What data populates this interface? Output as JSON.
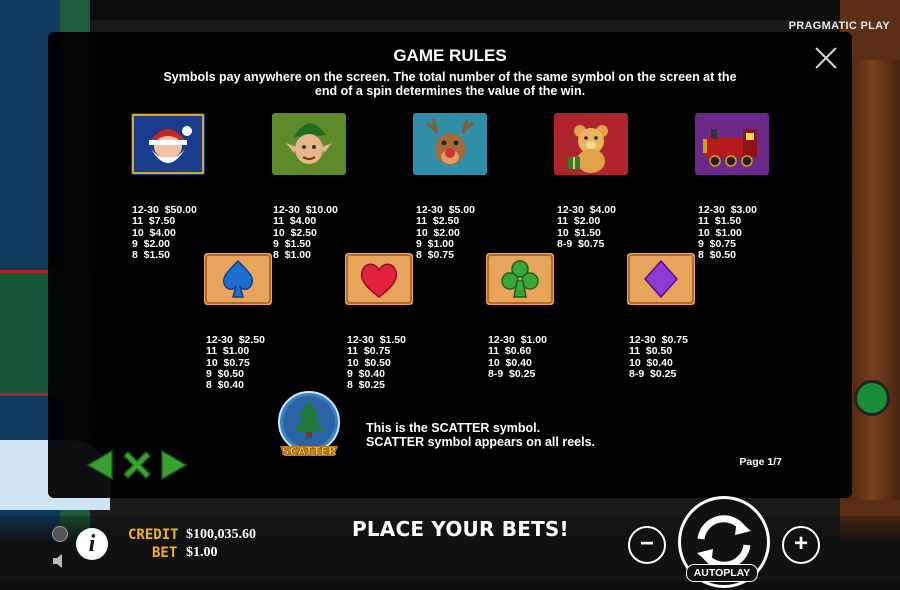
{
  "brand": "PRAGMATIC PLAY",
  "dialog": {
    "title": "GAME RULES",
    "subtitle": "Symbols pay anywhere on the screen. The total number of the same symbol on the screen at the end of a spin determines the value of the win.",
    "page": "Page 1/7"
  },
  "symbols_row1": [
    {
      "name": "santa",
      "pays": [
        "12-30  $50.00",
        "11  $7.50",
        "10  $4.00",
        "9  $2.00",
        "8  $1.50"
      ]
    },
    {
      "name": "elf",
      "pays": [
        "12-30  $10.00",
        "11  $4.00",
        "10  $2.50",
        "9  $1.50",
        "8  $1.00"
      ]
    },
    {
      "name": "reindeer",
      "pays": [
        "12-30  $5.00",
        "11  $2.50",
        "10  $2.00",
        "9  $1.00",
        "8  $0.75"
      ]
    },
    {
      "name": "teddy-bear",
      "pays": [
        "12-30  $4.00",
        "11  $2.00",
        "10  $1.50",
        "8-9  $0.75"
      ]
    },
    {
      "name": "train",
      "pays": [
        "12-30  $3.00",
        "11  $1.50",
        "10  $1.00",
        "9  $0.75",
        "8  $0.50"
      ]
    }
  ],
  "symbols_row2": [
    {
      "name": "spade",
      "pays": [
        "12-30  $2.50",
        "11  $1.00",
        "10  $0.75",
        "9  $0.50",
        "8  $0.40"
      ]
    },
    {
      "name": "heart",
      "pays": [
        "12-30  $1.50",
        "11  $0.75",
        "10  $0.50",
        "9  $0.40",
        "8  $0.25"
      ]
    },
    {
      "name": "club",
      "pays": [
        "12-30  $1.00",
        "11  $0.60",
        "10  $0.40",
        "8-9  $0.25"
      ]
    },
    {
      "name": "diamond",
      "pays": [
        "12-30  $0.75",
        "11  $0.50",
        "10  $0.40",
        "8-9  $0.25"
      ]
    }
  ],
  "scatter": {
    "label": "SCATTER",
    "line1": "This is the SCATTER symbol.",
    "line2": "SCATTER symbol appears on all reels."
  },
  "footer": {
    "credit_label": "CREDIT",
    "credit_value": "$100,035.60",
    "bet_label": "BET",
    "bet_value": "$1.00",
    "status": "PLACE YOUR BETS!",
    "autoplay": "AUTOPLAY",
    "info": "i",
    "minus": "−",
    "plus": "+"
  },
  "colors": {
    "accent_gold": "#f5b21b",
    "nav_green": "#39a12f",
    "panel": "#000000"
  }
}
